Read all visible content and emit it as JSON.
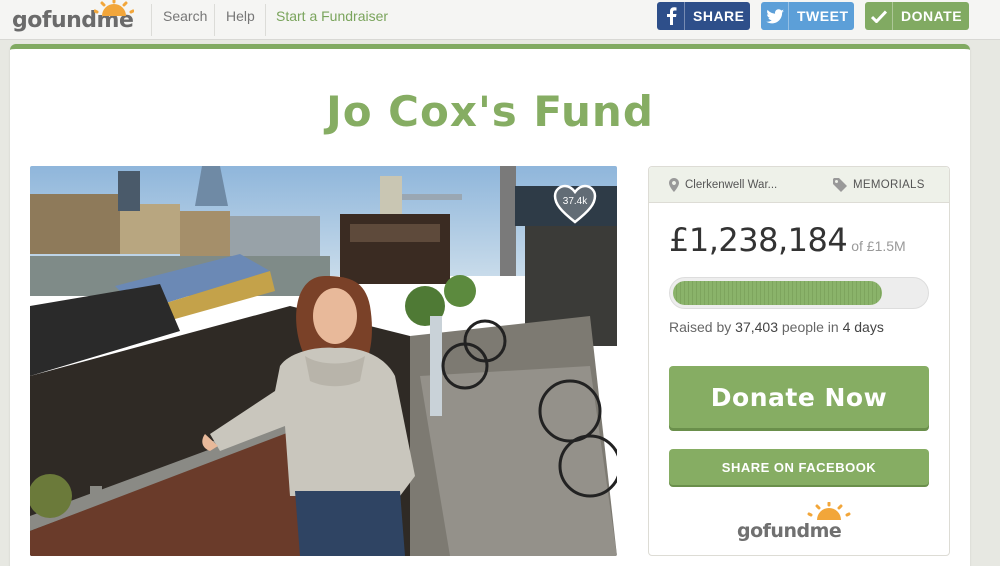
{
  "header": {
    "logo": {
      "go": "go",
      "fund": "fund",
      "me": "me"
    },
    "nav": {
      "search": "Search",
      "help": "Help",
      "start": "Start a Fundraiser"
    },
    "share": {
      "facebook": "SHARE",
      "twitter": "TWEET",
      "donate": "DONATE"
    },
    "colors": {
      "facebook": "#2e4f8a",
      "twitter": "#5c9fd8",
      "donate": "#81aa62"
    }
  },
  "campaign": {
    "title": "Jo Cox's Fund",
    "likes": "37.4k",
    "location": "Clerkenwell War...",
    "category": "MEMORIALS",
    "raised_amount": "£1,238,184",
    "goal": "of £1.5M",
    "progress": 0.83,
    "raised_by_prefix": "Raised by ",
    "people_count": "37,403",
    "people_in": " people in ",
    "days": "4 days",
    "donate_now": "Donate Now",
    "share_facebook": "SHARE ON FACEBOOK",
    "brand": {
      "go": "go",
      "fund": "fund",
      "me": "me"
    },
    "accent": "#86ad63"
  },
  "icons": {
    "facebook": "facebook-f-icon",
    "twitter": "twitter-bird-icon",
    "donate": "checkmark-icon",
    "location": "map-pin-icon",
    "category": "tag-icon",
    "heart": "heart-icon"
  }
}
